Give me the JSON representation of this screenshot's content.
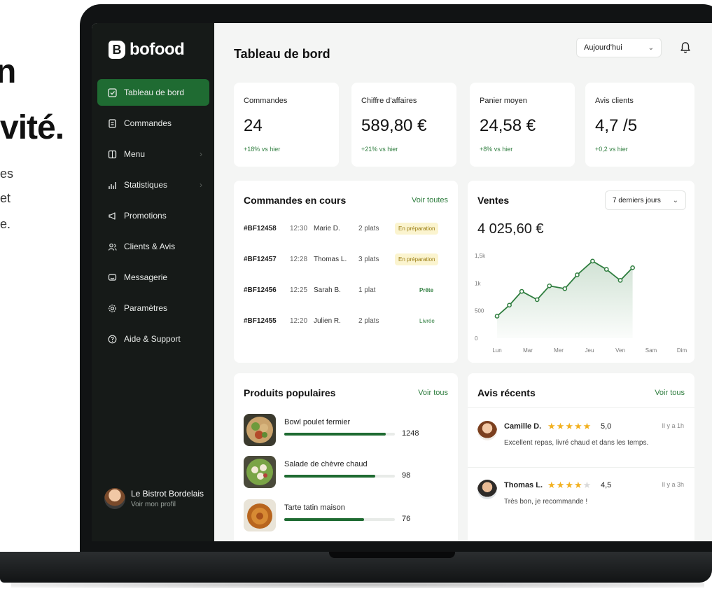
{
  "promo": {
    "line1": "n",
    "line2": "vité.",
    "line3": "es",
    "line4": "et",
    "line5": "e."
  },
  "sidebar": {
    "logo_text": "bofood",
    "items": [
      {
        "label": "Tableau de bord",
        "icon": "dashboard-icon",
        "active": true,
        "chevron": false
      },
      {
        "label": "Commandes",
        "icon": "orders-icon",
        "active": false,
        "chevron": false
      },
      {
        "label": "Menu",
        "icon": "menu-book-icon",
        "active": false,
        "chevron": true
      },
      {
        "label": "Statistiques",
        "icon": "stats-icon",
        "active": false,
        "chevron": true
      },
      {
        "label": "Promotions",
        "icon": "megaphone-icon",
        "active": false,
        "chevron": false
      },
      {
        "label": "Clients & Avis",
        "icon": "users-icon",
        "active": false,
        "chevron": false
      },
      {
        "label": "Messagerie",
        "icon": "message-icon",
        "active": false,
        "chevron": false
      },
      {
        "label": "Paramètres",
        "icon": "gear-icon",
        "active": false,
        "chevron": false
      },
      {
        "label": "Aide & Support",
        "icon": "help-icon",
        "active": false,
        "chevron": false
      }
    ],
    "profile": {
      "name": "Le Bistrot Bordelais",
      "link": "Voir mon profil"
    }
  },
  "header": {
    "title": "Tableau de bord",
    "date_filter": "Aujourd'hui"
  },
  "kpis": [
    {
      "label": "Commandes",
      "value": "24",
      "delta": "+18% vs hier"
    },
    {
      "label": "Chiffre d'affaires",
      "value": "589,80 €",
      "delta": "+21% vs hier"
    },
    {
      "label": "Panier moyen",
      "value": "24,58 €",
      "delta": "+8% vs hier"
    },
    {
      "label": "Avis clients",
      "value": "4,7 /5",
      "delta": "+0,2 vs hier"
    }
  ],
  "orders": {
    "title": "Commandes en cours",
    "link": "Voir toutes",
    "rows": [
      {
        "id": "#BF12458",
        "time": "12:30",
        "customer": "Marie D.",
        "qty": "2 plats",
        "status": "En préparation",
        "kind": "prep"
      },
      {
        "id": "#BF12457",
        "time": "12:28",
        "customer": "Thomas L.",
        "qty": "3 plats",
        "status": "En préparation",
        "kind": "prep"
      },
      {
        "id": "#BF12456",
        "time": "12:25",
        "customer": "Sarah B.",
        "qty": "1 plat",
        "status": "Prête",
        "kind": "ready"
      },
      {
        "id": "#BF12455",
        "time": "12:20",
        "customer": "Julien R.",
        "qty": "2 plats",
        "status": "Livrée",
        "kind": "done"
      }
    ]
  },
  "sales": {
    "title": "Ventes",
    "period": "7 derniers jours",
    "total": "4 025,60 €"
  },
  "chart_data": {
    "type": "area",
    "x": [
      "Lun",
      "Mar",
      "Mer",
      "Jeu",
      "Ven",
      "Sam",
      "Dim"
    ],
    "series": [
      {
        "values": [
          400,
          600,
          850,
          700,
          950,
          900,
          1150,
          1400,
          1250,
          1050,
          1280
        ]
      }
    ],
    "x_points": [
      0,
      0.4,
      0.8,
      1.3,
      1.7,
      2.2,
      2.6,
      3.1,
      3.55,
      4.0,
      4.4
    ],
    "yticks": [
      "0",
      "500",
      "1k",
      "1,5k"
    ],
    "ylim": [
      0,
      1500
    ],
    "color": "#2e7d3e"
  },
  "products": {
    "title": "Produits populaires",
    "link": "Voir tous",
    "items": [
      {
        "name": "Bowl poulet fermier",
        "count": "1248",
        "share": 0.92
      },
      {
        "name": "Salade de chèvre chaud",
        "count": "98",
        "share": 0.82
      },
      {
        "name": "Tarte tatin maison",
        "count": "76",
        "share": 0.72
      }
    ]
  },
  "reviews": {
    "title": "Avis récents",
    "link": "Voir tous",
    "items": [
      {
        "name": "Camille D.",
        "stars": 5,
        "score": "5,0",
        "when": "Il y a 1h",
        "text": "Excellent repas, livré chaud et dans les temps."
      },
      {
        "name": "Thomas L.",
        "stars": 4,
        "score": "4,5",
        "when": "Il y a 3h",
        "text": "Très bon, je recommande !"
      }
    ]
  },
  "colors": {
    "accent": "#1f6b32",
    "sidebar": "#161a18",
    "star": "#f2b01e"
  }
}
